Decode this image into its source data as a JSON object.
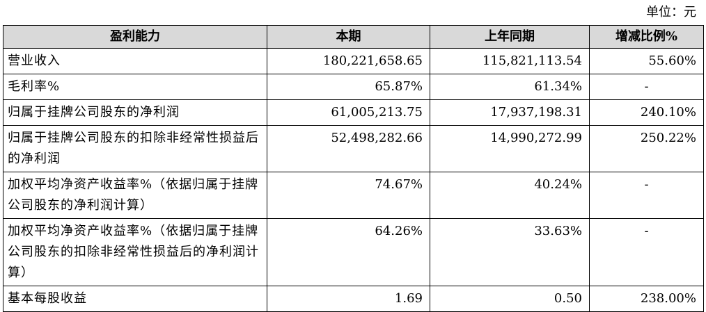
{
  "unit_label": "单位：元",
  "table": {
    "headers": [
      "盈利能力",
      "本期",
      "上年同期",
      "增减比例%"
    ],
    "rows": [
      {
        "item": "营业收入",
        "current": "180,221,658.65",
        "prior": "115,821,113.54",
        "change": "55.60%"
      },
      {
        "item": "毛利率%",
        "current": "65.87%",
        "prior": "61.34%",
        "change": "-"
      },
      {
        "item": "归属于挂牌公司股东的净利润",
        "current": "61,005,213.75",
        "prior": "17,937,198.31",
        "change": "240.10%"
      },
      {
        "item": "归属于挂牌公司股东的扣除非经常性损益后的净利润",
        "current": "52,498,282.66",
        "prior": "14,990,272.99",
        "change": "250.22%"
      },
      {
        "item": "加权平均净资产收益率%（依据归属于挂牌公司股东的净利润计算）",
        "current": "74.67%",
        "prior": "40.24%",
        "change": "-"
      },
      {
        "item": "加权平均净资产收益率%（依据归属于挂牌公司股东的扣除非经常性损益后的净利润计算）",
        "current": "64.26%",
        "prior": "33.63%",
        "change": "-"
      },
      {
        "item": "基本每股收益",
        "current": "1.69",
        "prior": "0.50",
        "change": "238.00%"
      }
    ]
  }
}
